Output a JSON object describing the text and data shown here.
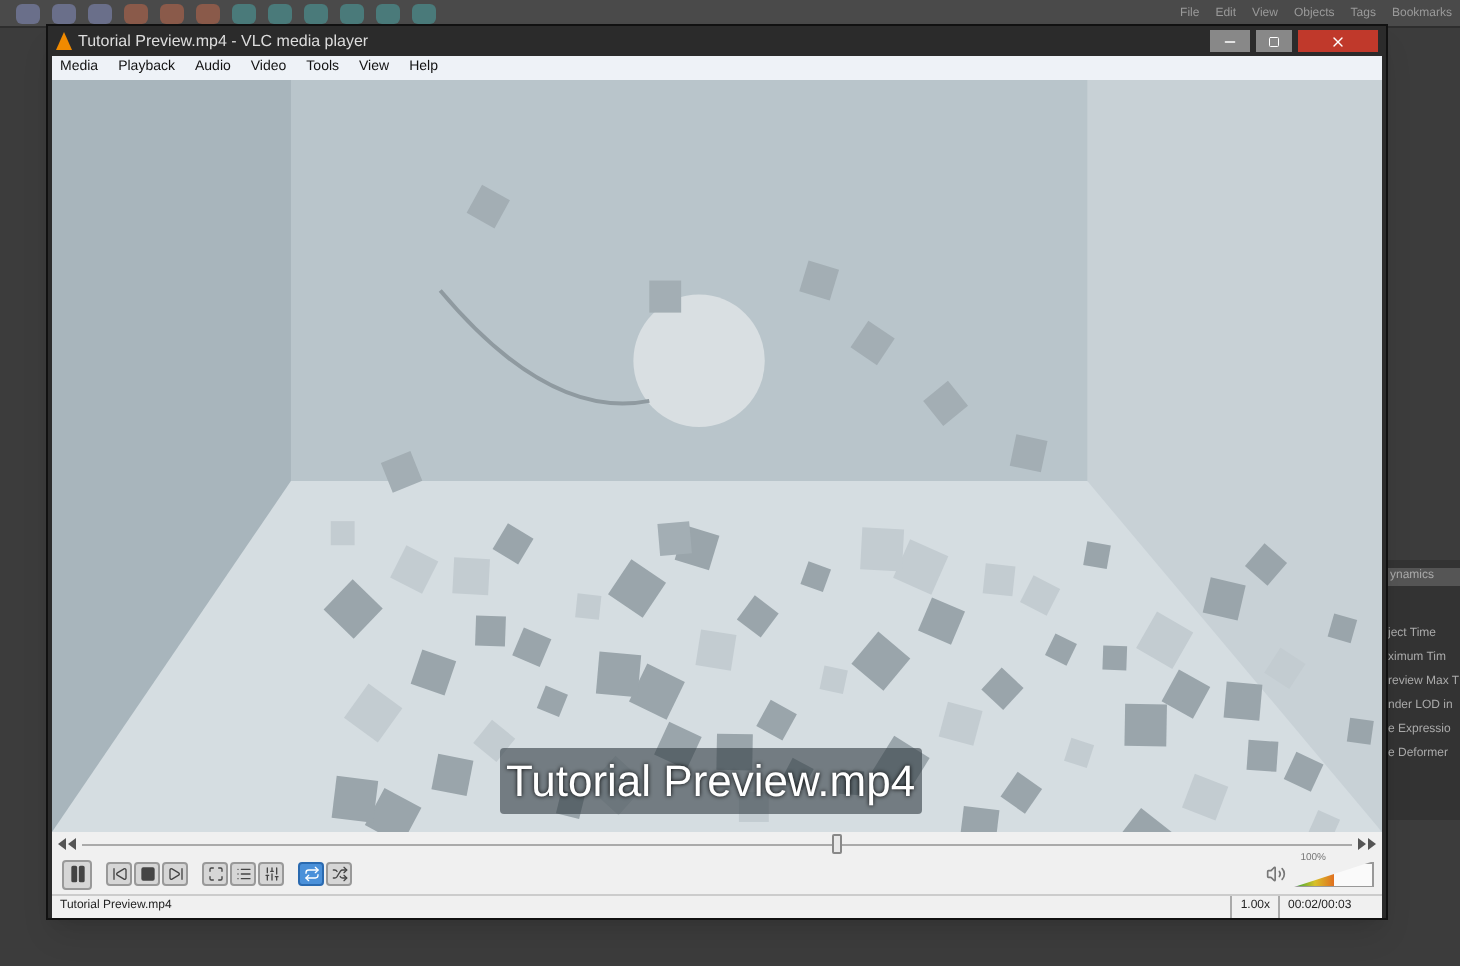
{
  "background_app": {
    "menu": [
      "File",
      "Edit",
      "View",
      "Objects",
      "Tags",
      "Bookmarks"
    ],
    "panel_tab": "ynamics",
    "panel_items": [
      "ject Time",
      "ximum Tim",
      "review Max T",
      "nder LOD in",
      "e Expressio",
      "e Deformer"
    ]
  },
  "window": {
    "title": "Tutorial Preview.mp4 - VLC media player"
  },
  "menu": [
    "Media",
    "Playback",
    "Audio",
    "Video",
    "Tools",
    "View",
    "Help"
  ],
  "video": {
    "kind": "picture",
    "osd_title": "Tutorial Preview.mp4"
  },
  "seek": {
    "level": 0.59
  },
  "controls": [
    {
      "kind": "pause",
      "selected": false
    },
    {
      "kind": "previous",
      "selected": false
    },
    {
      "kind": "stop",
      "selected": false
    },
    {
      "kind": "next",
      "selected": false
    },
    {
      "kind": "fullscreen",
      "selected": false
    },
    {
      "kind": "playlist",
      "selected": false
    },
    {
      "kind": "settings",
      "selected": false
    },
    {
      "kind": "loop",
      "selected": true
    },
    {
      "kind": "shuffle",
      "selected": false
    }
  ],
  "volume": {
    "level": 0.5,
    "reading": "100%"
  },
  "status": {
    "file": "Tutorial Preview.mp4",
    "speed": "1.00x",
    "time": "00:02/00:03"
  }
}
